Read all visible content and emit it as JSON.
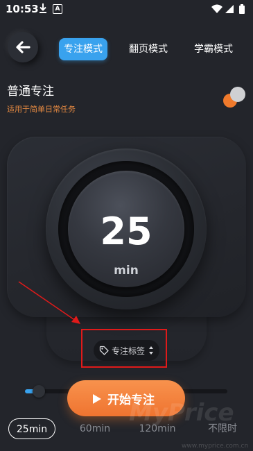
{
  "status_bar": {
    "time": "10:53",
    "notification_icon": "download-icon",
    "app_icon": "a-icon",
    "app_icon_letter": "A",
    "indicators": [
      "wifi-icon",
      "signal-icon",
      "battery-icon"
    ]
  },
  "header": {
    "back_icon": "back-arrow-icon",
    "tabs": [
      {
        "label": "专注模式",
        "active": true
      },
      {
        "label": "翻页模式",
        "active": false
      },
      {
        "label": "学霸模式",
        "active": false
      }
    ]
  },
  "mode": {
    "title": "普通专注",
    "subtitle": "适用于简单日常任务",
    "toggle_on": false
  },
  "timer": {
    "value": "25",
    "unit": "min"
  },
  "focus_tag": {
    "icon": "tag-icon",
    "label": "专注标签",
    "sort_icon": "sort-icon"
  },
  "slider": {
    "progress_fraction": 0.06
  },
  "start_button": {
    "icon": "play-icon",
    "label": "开始专注"
  },
  "durations": [
    {
      "label": "25min",
      "selected": true
    },
    {
      "label": "60min",
      "selected": false
    },
    {
      "label": "120min",
      "selected": false
    },
    {
      "label": "不限时",
      "selected": false
    }
  ],
  "watermark": {
    "text": "MyPrice",
    "url": "www.myprice.com.cn"
  },
  "colors": {
    "background": "#23252b",
    "accent_blue": "#39a2ee",
    "accent_orange": "#f07a2c",
    "subtitle_orange": "#e88b42",
    "annotation_red": "#e01a1a"
  }
}
